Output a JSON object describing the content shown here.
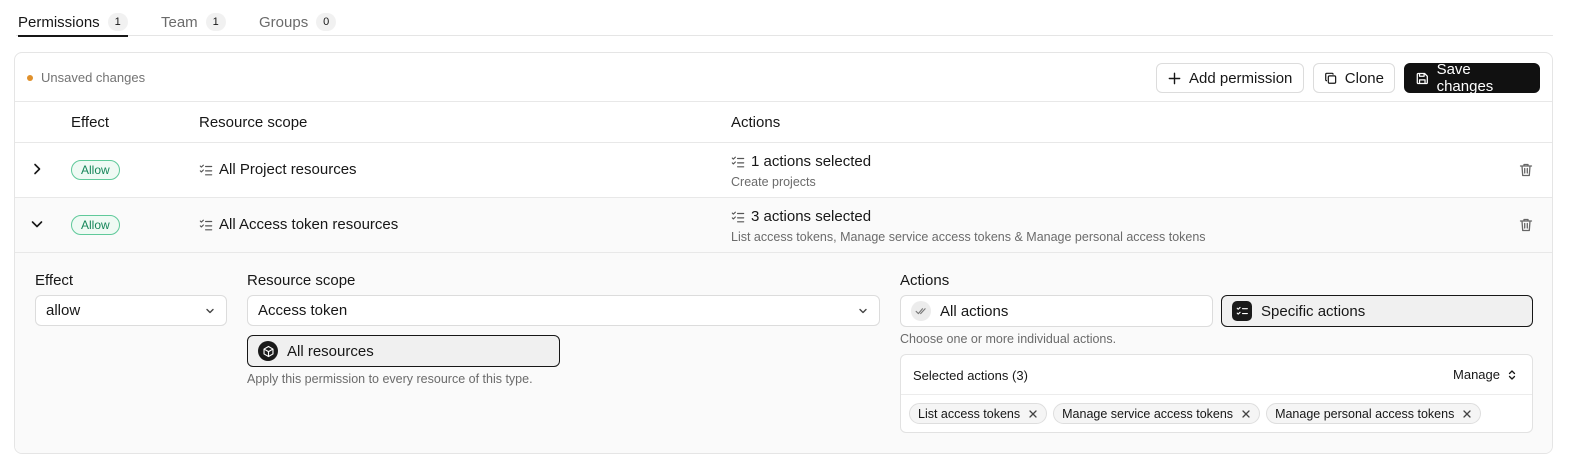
{
  "tabs": [
    {
      "label": "Permissions",
      "count": "1"
    },
    {
      "label": "Team",
      "count": "1"
    },
    {
      "label": "Groups",
      "count": "0"
    }
  ],
  "toolbar": {
    "status": "Unsaved changes",
    "add_label": "Add permission",
    "clone_label": "Clone",
    "save_label": "Save changes",
    "status_color": "#e0902b"
  },
  "table": {
    "headers": {
      "effect": "Effect",
      "scope": "Resource scope",
      "actions": "Actions"
    },
    "rows": [
      {
        "effect": "Allow",
        "scope": "All Project resources",
        "actions_title": "1 actions selected",
        "actions_sub": "Create projects",
        "expanded": false
      },
      {
        "effect": "Allow",
        "scope": "All Access token resources",
        "actions_title": "3 actions selected",
        "actions_sub": "List access tokens, Manage service access tokens & Manage personal access tokens",
        "expanded": true
      }
    ]
  },
  "editor": {
    "effect_label": "Effect",
    "effect_value": "allow",
    "scope_label": "Resource scope",
    "scope_value": "Access token",
    "all_resources_label": "All resources",
    "all_resources_hint": "Apply this permission to every resource of this type.",
    "actions_label": "Actions",
    "all_actions_label": "All actions",
    "specific_actions_label": "Specific actions",
    "actions_hint": "Choose one or more individual actions.",
    "selected_title": "Selected actions (3)",
    "manage_label": "Manage",
    "chips": [
      "List access tokens",
      "Manage service access tokens",
      "Manage personal access tokens"
    ]
  },
  "icons": {
    "chevron_right": "chevron-right-icon",
    "chevron_down": "chevron-down-icon",
    "trash": "trash-icon",
    "list": "list-checks-icon",
    "plus": "plus-icon",
    "copy": "copy-icon",
    "save": "save-icon"
  },
  "colors": {
    "badge_border": "#5fc99a",
    "badge_text": "#16865a",
    "primary": "#111111"
  }
}
